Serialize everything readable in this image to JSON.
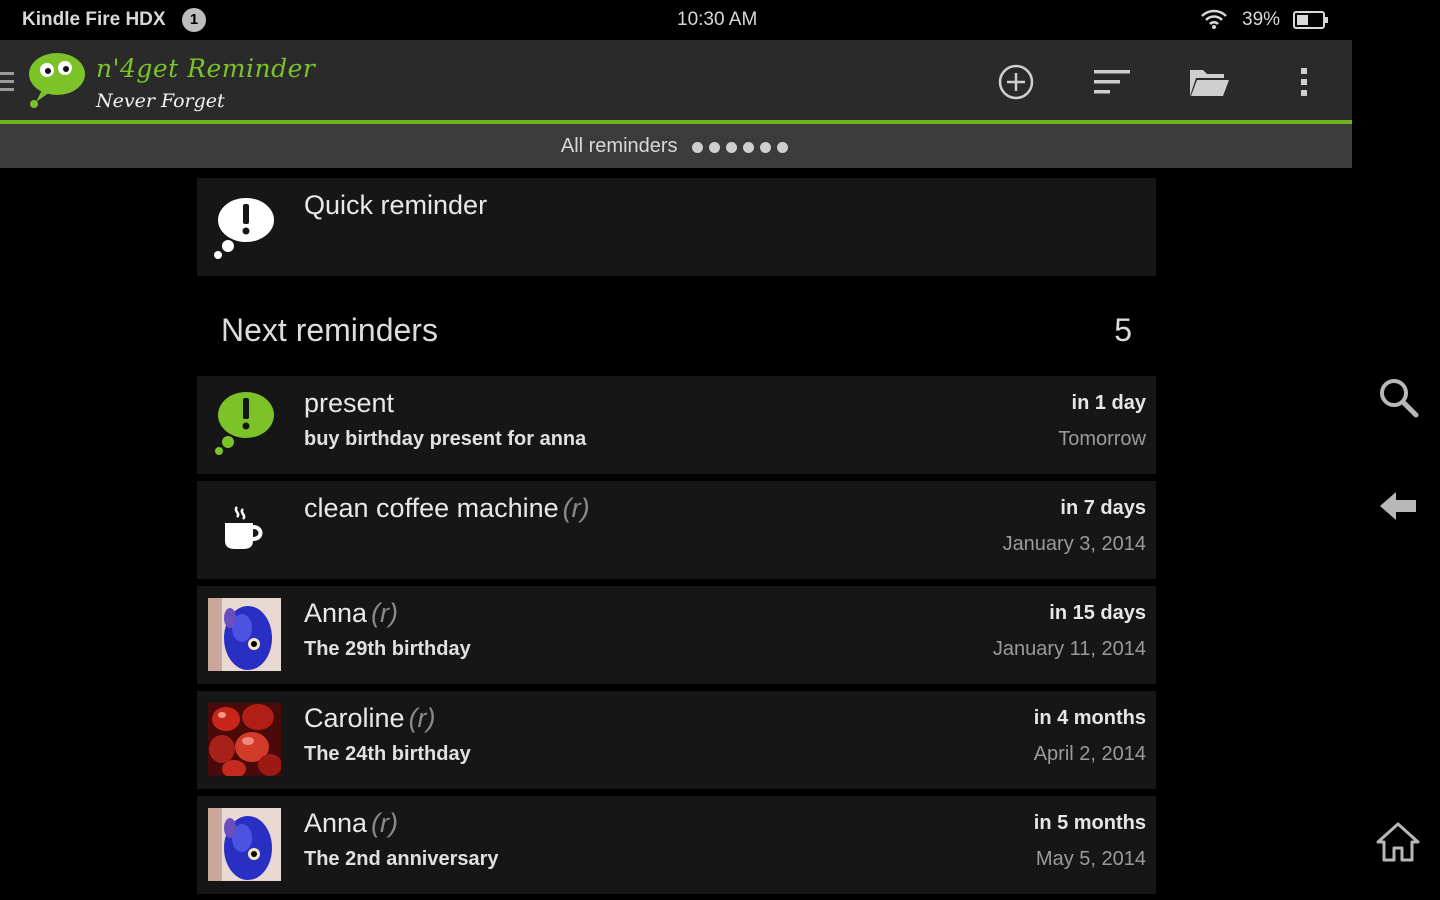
{
  "status_bar": {
    "device_name": "Kindle Fire HDX",
    "notification_count": "1",
    "time": "10:30 AM",
    "battery": "39%",
    "icons": [
      "notification-badge-icon",
      "wifi-icon",
      "battery-icon"
    ]
  },
  "action_bar": {
    "app_name": "n'4get Reminder",
    "tagline": "Never Forget",
    "accent": "#6fb11f",
    "actions": [
      "add-icon",
      "sort-icon",
      "folder-icon",
      "overflow-menu-icon"
    ]
  },
  "filter": {
    "label": "All reminders",
    "page_dots": 6
  },
  "quick_reminder": {
    "label": "Quick reminder",
    "icon": "exclamation-bubble-icon"
  },
  "next_reminders": {
    "title": "Next reminders",
    "count": "5",
    "items": [
      {
        "name": "present",
        "recurring": "",
        "subtitle": "buy birthday present for anna",
        "relative": "in 1 day",
        "date": "Tomorrow",
        "icon": "green-exclamation-bubble-icon"
      },
      {
        "name": "clean coffee machine",
        "recurring": "(r)",
        "subtitle": "",
        "relative": "in 7 days",
        "date": "January 3, 2014",
        "icon": "coffee-cup-icon"
      },
      {
        "name": "Anna",
        "recurring": "(r)",
        "subtitle": "The 29th birthday",
        "relative": "in 15 days",
        "date": "January 11, 2014",
        "icon": "contact-photo-blue"
      },
      {
        "name": "Caroline",
        "recurring": "(r)",
        "subtitle": "The 24th birthday",
        "relative": "in 4 months",
        "date": "April 2, 2014",
        "icon": "contact-photo-red"
      },
      {
        "name": "Anna",
        "recurring": "(r)",
        "subtitle": "The 2nd anniversary",
        "relative": "in 5 months",
        "date": "May 5, 2014",
        "icon": "contact-photo-blue"
      }
    ]
  },
  "side_nav": [
    "search-icon",
    "back-icon",
    "home-icon"
  ]
}
